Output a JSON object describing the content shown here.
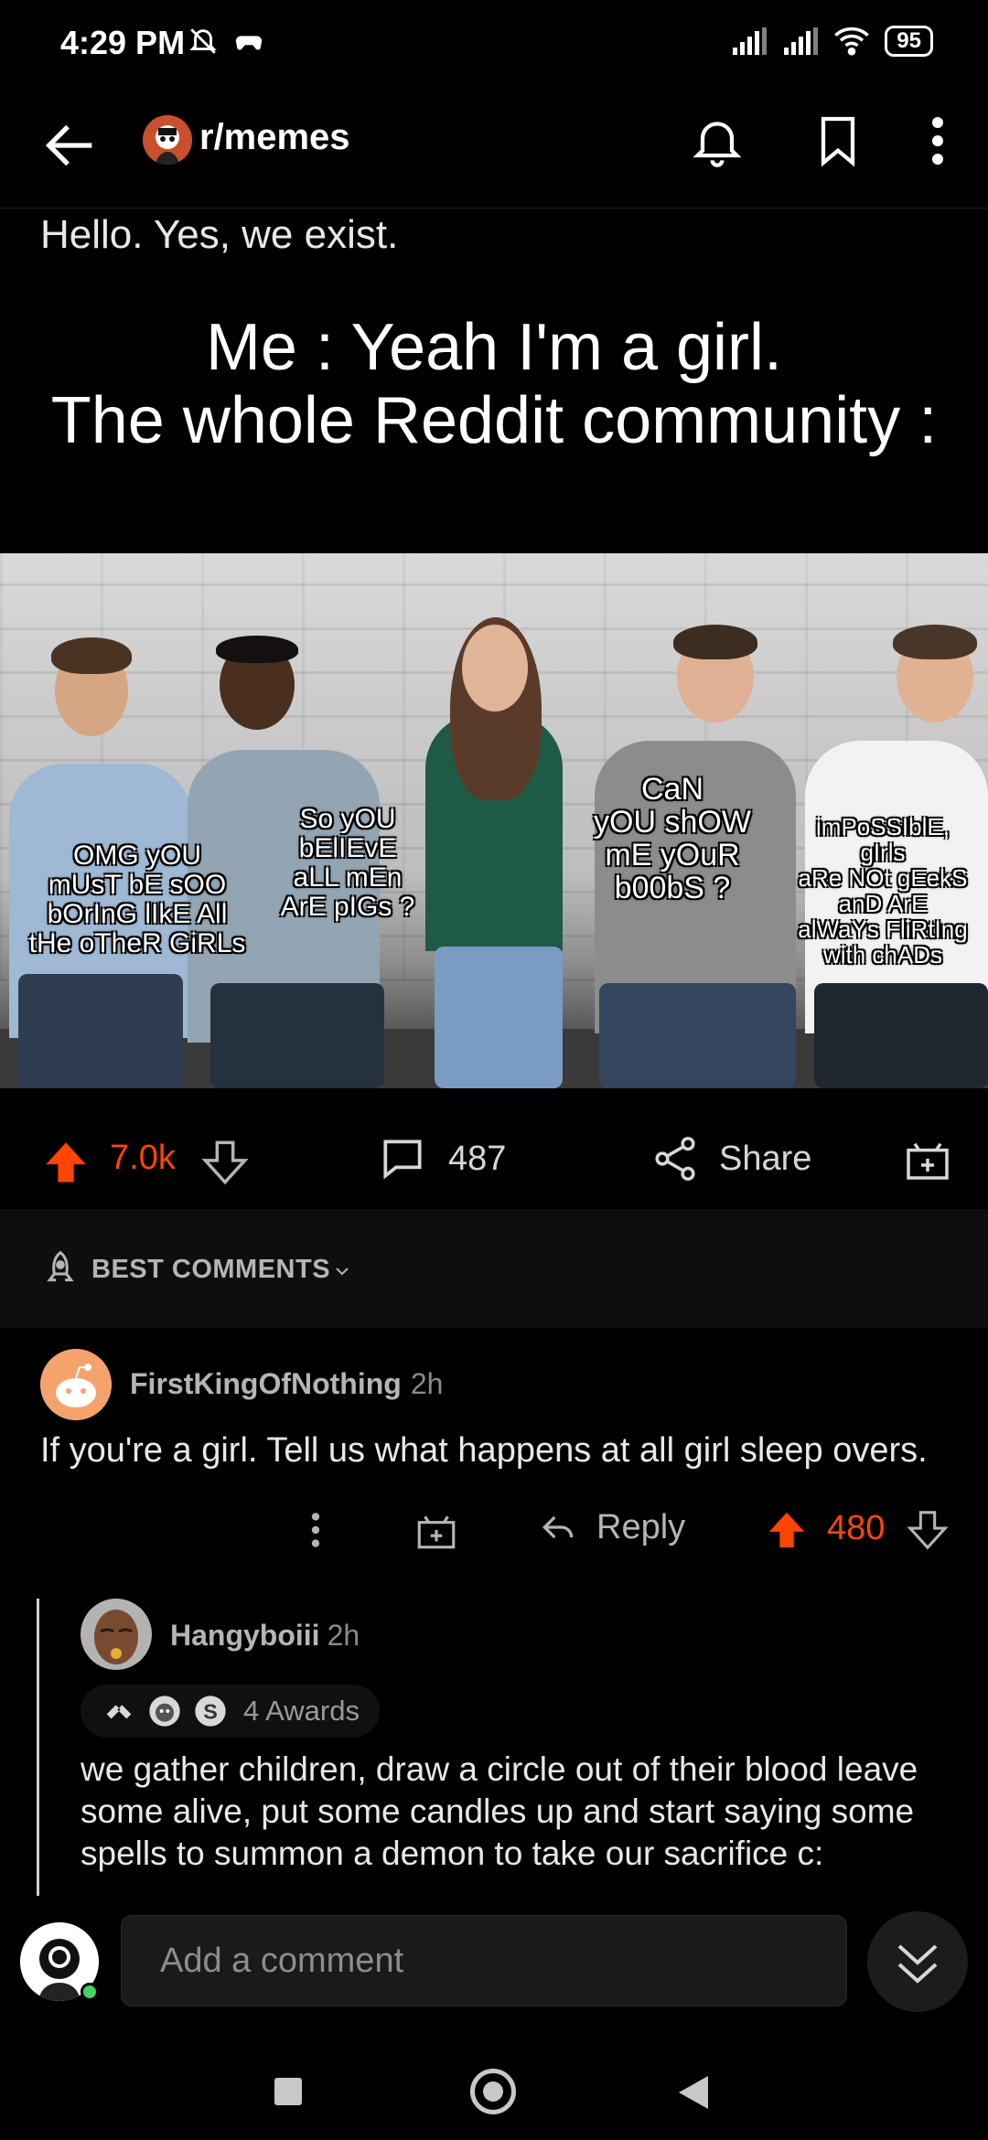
{
  "status_bar": {
    "time": "4:29 PM",
    "battery": "95",
    "icons": [
      "mute-bell-icon",
      "game-controller-icon",
      "signal-icon",
      "signal-icon",
      "wifi-icon",
      "battery-icon"
    ]
  },
  "app_bar": {
    "subreddit": "r/memes",
    "icons": [
      "back-arrow-icon",
      "bell-icon",
      "bookmark-icon",
      "more-vertical-icon"
    ]
  },
  "post": {
    "title": "Hello. Yes, we exist.",
    "image_caption_line1": "Me : Yeah I'm a girl.",
    "image_caption_line2": "The whole Reddit community :",
    "bubbles": [
      "OMG yOU\nmUsT bE sOO\nbOrInG lIkE All\ntHe oTheR GiRLs",
      "So yOU\nbElIEvE\naLL mEn\nArE pIGs ?",
      "CaN\nyOU shOW\nmE yOuR\nb00bS ?",
      "imPoSSIblE,\ngIrls\naRe NOt gEekS\nanD ArE\nalWaYs FliRtIng\nwith chADs"
    ]
  },
  "actions": {
    "score": "7.0k",
    "comments": "487",
    "share": "Share",
    "accent": "#ff4500"
  },
  "sort": {
    "label": "BEST COMMENTS"
  },
  "comment1": {
    "author": "FirstKingOfNothing",
    "time": "2h",
    "body": "If you're a girl. Tell us what happens at all girl sleep overs.",
    "reply": "Reply",
    "score": "480"
  },
  "comment2": {
    "author": "Hangyboiii",
    "time": "2h",
    "awards": "4 Awards",
    "body": "we gather children, draw a circle out of their blood leave some alive, put some candles up and start saying some spells to summon a demon to take our sacrifice c:"
  },
  "composer": {
    "placeholder": "Add a comment"
  }
}
